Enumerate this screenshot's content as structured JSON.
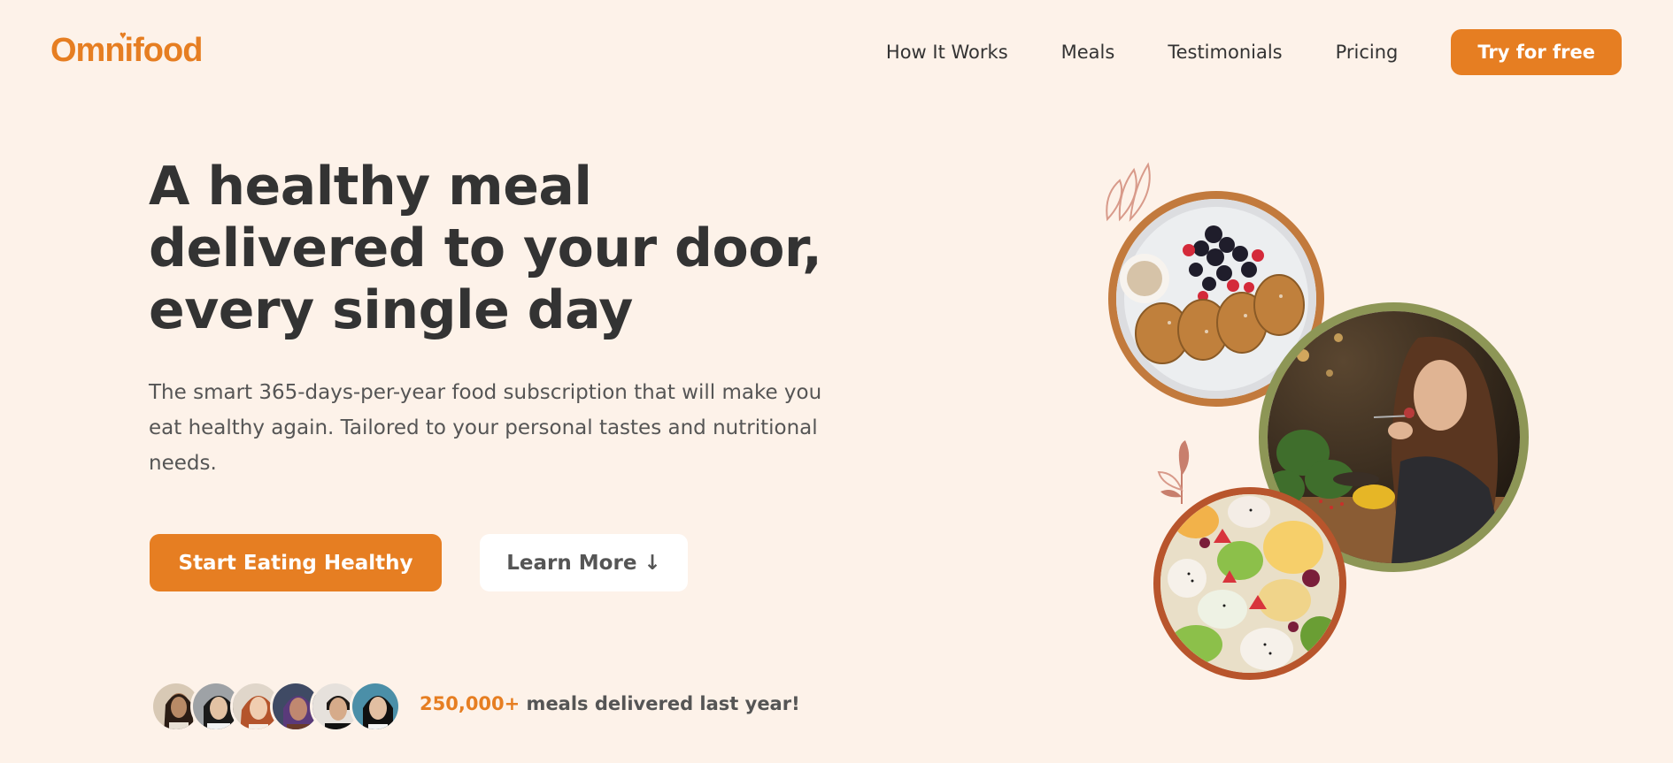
{
  "header": {
    "logo": "Omnifood",
    "nav": [
      "How It Works",
      "Meals",
      "Testimonials",
      "Pricing"
    ],
    "cta": "Try for free"
  },
  "hero": {
    "title": "A healthy meal delivered to your door, every single day",
    "description": "The smart 365-days-per-year food subscription that will make you eat healthy again. Tailored to your personal tastes and nutritional needs.",
    "primary_button": "Start Eating Healthy",
    "secondary_button": "Learn More ↓"
  },
  "delivered": {
    "number": "250,000+",
    "text": " meals delivered last year!"
  },
  "colors": {
    "brand": "#e67e22",
    "background": "#fdf2e9",
    "text": "#333333",
    "ring_1": "#c27a3d",
    "ring_2": "#8d9656",
    "ring_3": "#b8552c"
  },
  "images": [
    "french-toast-berries-plate",
    "woman-eating-salad-restaurant",
    "fruit-salad-bowl"
  ],
  "avatars": [
    "customer-1",
    "customer-2",
    "customer-3",
    "customer-4",
    "customer-5",
    "customer-6"
  ]
}
